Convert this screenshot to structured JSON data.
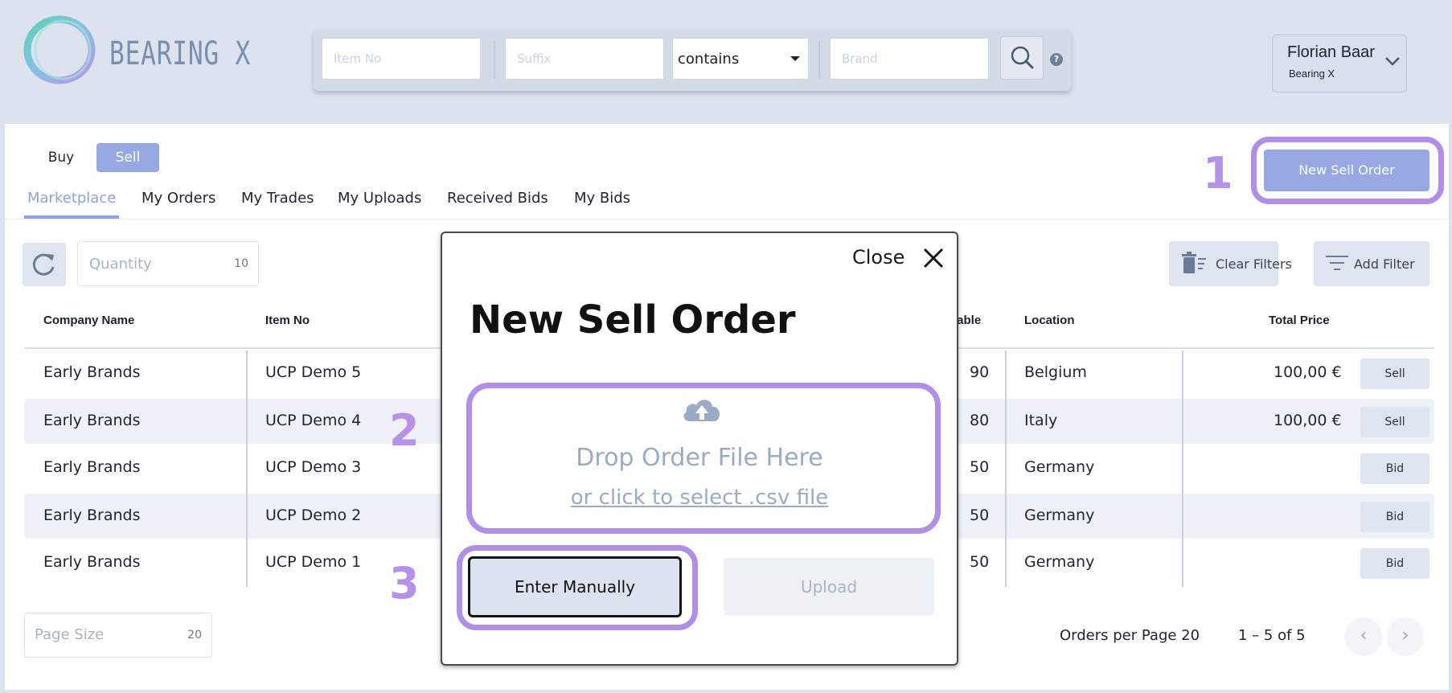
{
  "header": {
    "brand": "BEARING X",
    "search": {
      "item_no_placeholder": "Item No",
      "suffix_placeholder": "Suffix",
      "match_mode": "contains",
      "brand_placeholder": "Brand",
      "help": "?"
    },
    "user": {
      "name": "Florian Baar",
      "org": "Bearing X"
    }
  },
  "mode_toggle": {
    "buy": "Buy",
    "sell": "Sell",
    "active": "Sell"
  },
  "tabs": [
    "Marketplace",
    "My Orders",
    "My Trades",
    "My Uploads",
    "Received Bids",
    "My Bids"
  ],
  "active_tab": "Marketplace",
  "new_sell_order_label": "New Sell Order",
  "callouts": [
    "1",
    "2",
    "3"
  ],
  "filters": {
    "quantity_label": "Quantity",
    "quantity_value": "10",
    "clear_filters": "Clear Filters",
    "add_filter": "Add Filter"
  },
  "table": {
    "columns": [
      "Company Name",
      "Item No",
      "lable",
      "Location",
      "Total Price"
    ],
    "rows": [
      {
        "company": "Early Brands",
        "item": "UCP Demo 5",
        "avail": "90",
        "location": "Belgium",
        "price": "100,00 €",
        "action": "Sell"
      },
      {
        "company": "Early Brands",
        "item": "UCP Demo 4",
        "avail": "80",
        "location": "Italy",
        "price": "100,00 €",
        "action": "Sell"
      },
      {
        "company": "Early Brands",
        "item": "UCP Demo 3",
        "avail": "50",
        "location": "Germany",
        "price": "",
        "action": "Bid"
      },
      {
        "company": "Early Brands",
        "item": "UCP Demo 2",
        "avail": "50",
        "location": "Germany",
        "price": "",
        "action": "Bid"
      },
      {
        "company": "Early Brands",
        "item": "UCP Demo 1",
        "avail": "50",
        "location": "Germany",
        "price": "",
        "action": "Bid"
      }
    ]
  },
  "pagination": {
    "page_size_label": "Page Size",
    "page_size_value": "20",
    "orders_per_page": "Orders per Page 20",
    "range": "1 – 5 of 5",
    "prev": "‹",
    "next": "›"
  },
  "modal": {
    "close_label": "Close",
    "title": "New Sell Order",
    "drop_text": "Drop Order File Here",
    "drop_link": "or click to select .csv file",
    "enter_manually": "Enter Manually",
    "upload": "Upload"
  },
  "colors": {
    "accent": "#96a9e3",
    "highlight": "#b18ee8",
    "page_bg": "#dce3ee"
  }
}
